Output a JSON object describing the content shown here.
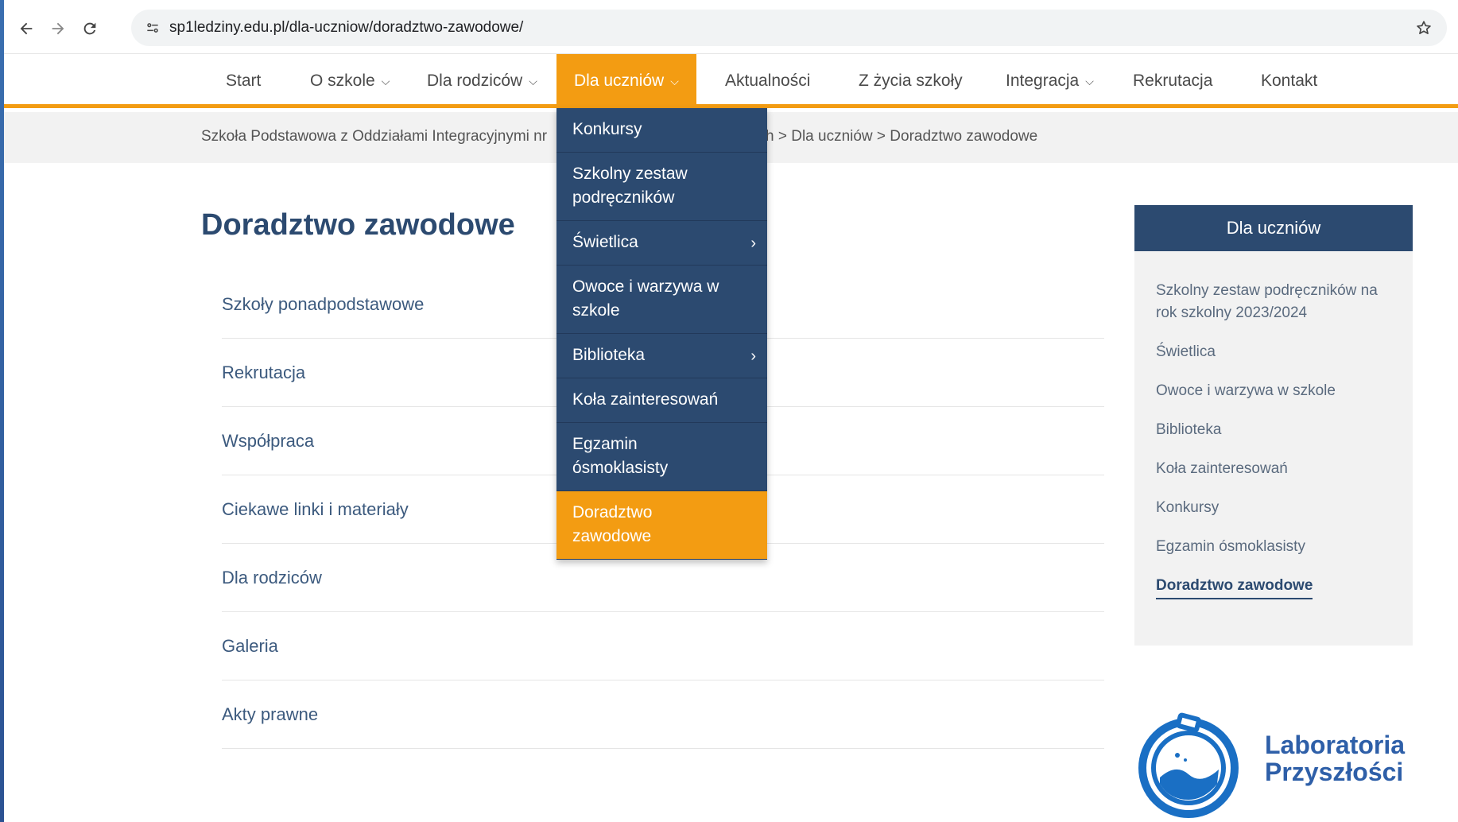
{
  "browser": {
    "url": "sp1ledziny.edu.pl/dla-uczniow/doradztwo-zawodowe/"
  },
  "nav": {
    "items": [
      {
        "label": "Start",
        "has_dropdown": false
      },
      {
        "label": "O szkole",
        "has_dropdown": true
      },
      {
        "label": "Dla rodziców",
        "has_dropdown": true
      },
      {
        "label": "Dla uczniów",
        "has_dropdown": true,
        "active": true
      },
      {
        "label": "Aktualności",
        "has_dropdown": false
      },
      {
        "label": "Z życia szkoły",
        "has_dropdown": false
      },
      {
        "label": "Integracja",
        "has_dropdown": true
      },
      {
        "label": "Rekrutacja",
        "has_dropdown": false
      },
      {
        "label": "Kontakt",
        "has_dropdown": false
      }
    ],
    "accent_color": "#f39c12",
    "primary_color": "#2c4a70"
  },
  "breadcrumb": {
    "left": "Szkoła Podstawowa z Oddziałami Integracyjnymi nr",
    "right": "h > Dla uczniów > Doradztwo zawodowe"
  },
  "page": {
    "title": "Doradztwo zawodowe",
    "subpages": [
      "Szkoły ponadpodstawowe",
      "Rekrutacja",
      "Współpraca",
      "Ciekawe linki i materiały",
      "Dla rodziców",
      "Galeria",
      "Akty prawne"
    ]
  },
  "dropdown": {
    "items": [
      {
        "label": "Konkursy",
        "has_submenu": false
      },
      {
        "label": "Szkolny zestaw podręczników",
        "has_submenu": false
      },
      {
        "label": "Świetlica",
        "has_submenu": true
      },
      {
        "label": "Owoce i warzywa w szkole",
        "has_submenu": false
      },
      {
        "label": "Biblioteka",
        "has_submenu": true
      },
      {
        "label": "Koła zainteresowań",
        "has_submenu": false
      },
      {
        "label": "Egzamin ósmoklasisty",
        "has_submenu": false
      },
      {
        "label": "Doradztwo zawodowe",
        "has_submenu": false,
        "active": true
      }
    ]
  },
  "sidebar": {
    "title": "Dla uczniów",
    "items": [
      "Szkolny zestaw podręczników na rok szkolny 2023/2024",
      "Świetlica",
      "Owoce i warzywa w szkole",
      "Biblioteka",
      "Koła zainteresowań",
      "Konkursy",
      "Egzamin ósmoklasisty",
      "Doradztwo zawodowe"
    ],
    "current": "Doradztwo zawodowe"
  },
  "logo": {
    "line1": "Laboratoria",
    "line2": "Przyszłości"
  },
  "icons": [
    "back-icon",
    "forward-icon",
    "reload-icon",
    "site-info-icon",
    "bookmark-star-icon",
    "chevron-down-icon",
    "chevron-right-icon",
    "flask-logo-icon"
  ]
}
